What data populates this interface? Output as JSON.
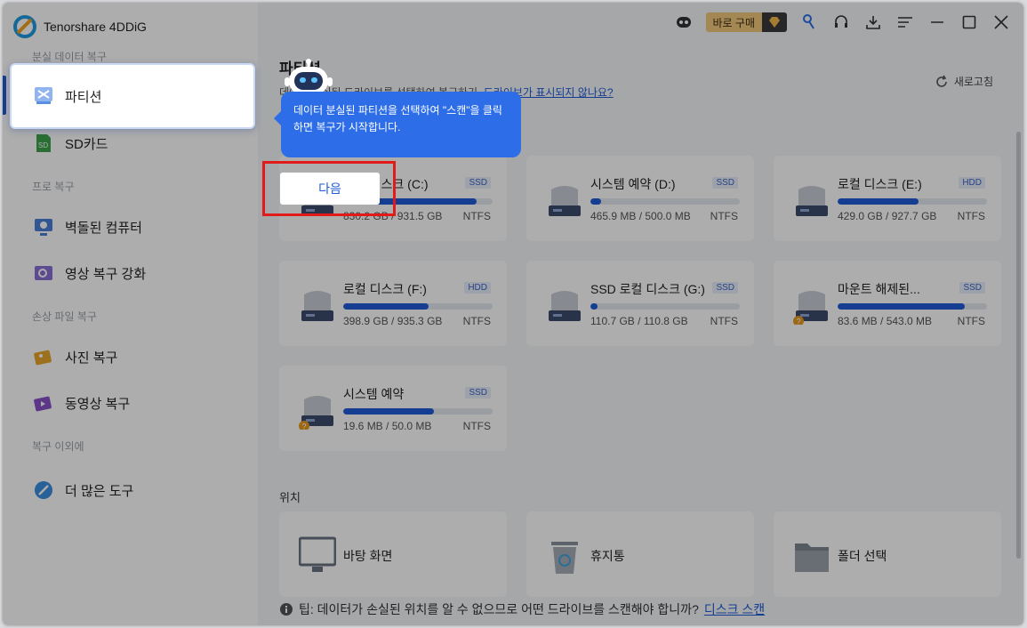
{
  "app": {
    "title": "Tenorshare 4DDiG"
  },
  "topbar": {
    "buy_label": "바로 구매"
  },
  "sidebar": {
    "sections": [
      {
        "heading": "분실 데이터 복구"
      },
      {
        "heading": "프로 복구"
      },
      {
        "heading": "손상 파일 복구"
      },
      {
        "heading": "복구 이외에"
      }
    ],
    "items": [
      {
        "label": "파티션",
        "icon": "partition-icon"
      },
      {
        "label": "SD카드",
        "icon": "sd-card-icon"
      },
      {
        "label": "벽돌된 컴퓨터",
        "icon": "crashed-computer-icon"
      },
      {
        "label": "영상 복구 강화",
        "icon": "video-enhance-icon"
      },
      {
        "label": "사진 복구",
        "icon": "photo-icon"
      },
      {
        "label": "동영상 복구",
        "icon": "video-icon"
      },
      {
        "label": "더 많은 도구",
        "icon": "tools-icon"
      }
    ]
  },
  "main": {
    "title": "파티션",
    "subtitle": "데이터 분실된 드라이브를 선택하여 복구하기.",
    "subtitle_link": "드라이브가 표시되지 않나요?",
    "refresh": "새로고침",
    "drives": [
      {
        "name": "로컬 디스크 (C:)",
        "tag": "SSD",
        "size": "830.2 GB / 931.5 GB",
        "fs": "NTFS",
        "used": 0.89
      },
      {
        "name": "시스템 예약 (D:)",
        "tag": "SSD",
        "size": "465.9 MB / 500.0 MB",
        "fs": "NTFS",
        "used": 0.07
      },
      {
        "name": "로컬 디스크 (E:)",
        "tag": "HDD",
        "size": "429.0 GB / 927.7 GB",
        "fs": "NTFS",
        "used": 0.54
      },
      {
        "name": "로컬 디스크 (F:)",
        "tag": "HDD",
        "size": "398.9 GB / 935.3 GB",
        "fs": "NTFS",
        "used": 0.57
      },
      {
        "name": "SSD 로컬 디스크 (G:)",
        "tag": "SSD",
        "size": "110.7 GB / 110.8 GB",
        "fs": "NTFS",
        "used": 0.01
      },
      {
        "name": "마운트 해제된...",
        "tag": "SSD",
        "size": "83.6 MB / 543.0 MB",
        "fs": "NTFS",
        "used": 0.85
      },
      {
        "name": "시스템 예약",
        "tag": "SSD",
        "size": "19.6 MB / 50.0 MB",
        "fs": "NTFS",
        "used": 0.61
      }
    ],
    "location_heading": "위치",
    "locations": [
      {
        "name": "바탕 화면",
        "icon": "desktop-icon"
      },
      {
        "name": "휴지통",
        "icon": "recycle-bin-icon"
      },
      {
        "name": "폴더 선택",
        "icon": "folder-icon"
      }
    ],
    "tip_text": "팁: 데이터가 손실된 위치를 알 수 없으므로 어떤 드라이브를 스캔해야 합니까?",
    "tip_link": "디스크 스캔"
  },
  "guide": {
    "text": "데이터 분실된 파티션을 선택하여 \"스캔\"을 클릭하면 복구가 시작합니다.",
    "next_button": "다음"
  },
  "colors": {
    "accent": "#1f5bd8",
    "bubble": "#2d6ee8",
    "highlight": "#e21a1a"
  }
}
